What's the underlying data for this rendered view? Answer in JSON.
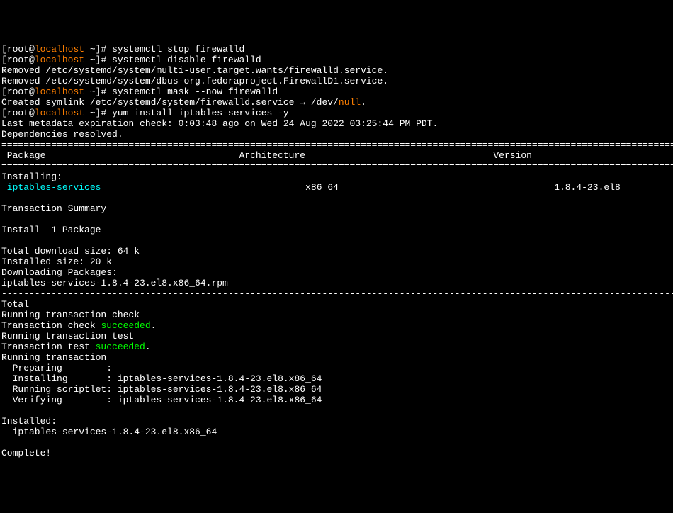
{
  "prompt": {
    "user": "root",
    "at": "@",
    "host": "localhost",
    "tail": " ~]# ",
    "open": "["
  },
  "cmd1": "systemctl stop firewalld",
  "cmd2": "systemctl disable firewalld",
  "removed1": "Removed /etc/systemd/system/multi-user.target.wants/firewalld.service.",
  "removed2": "Removed /etc/systemd/system/dbus-org.fedoraproject.FirewallD1.service.",
  "cmd3": "systemctl mask --now firewalld",
  "symlink1": "Created symlink /etc/systemd/system/firewalld.service → /dev/",
  "nullword": "null",
  "symlink2": ".",
  "cmd4": "yum install iptables-services -y",
  "metadata": "Last metadata expiration check: 0:03:48 ago on Wed 24 Aug 2022 03:25:44 PM PDT.",
  "depres": "Dependencies resolved.",
  "hdr_pkg": " Package",
  "hdr_arch": "Architecture",
  "hdr_ver": "Version",
  "installing": "Installing:",
  "pkg_name": " iptables-services",
  "pkg_arch": "x86_64",
  "pkg_ver": "1.8.4-23.el8",
  "txsummary": "Transaction Summary",
  "install1": "Install  1 Package",
  "dlsize": "Total download size: 64 k",
  "instsize": "Installed size: 20 k",
  "dlpkgs": "Downloading Packages:",
  "rpm": "iptables-services-1.8.4-23.el8.x86_64.rpm",
  "total": "Total",
  "rtcheck": "Running transaction check",
  "tcheck1": "Transaction check ",
  "succeeded": "succeeded",
  "dot": ".",
  "rttest": "Running transaction test",
  "ttest1": "Transaction test ",
  "rtx": "Running transaction",
  "prep": "  Preparing        :",
  "inst": "  Installing       : iptables-services-1.8.4-23.el8.x86_64",
  "script": "  Running scriptlet: iptables-services-1.8.4-23.el8.x86_64",
  "verify": "  Verifying        : iptables-services-1.8.4-23.el8.x86_64",
  "installed": "Installed:",
  "instpkg": "  iptables-services-1.8.4-23.el8.x86_64",
  "complete": "Complete!",
  "eqline": "==============================================================================================================================",
  "dashline": "------------------------------------------------------------------------------------------------------------------------------",
  "sp_arch": "                                   ",
  "sp_ver": "                                  ",
  "sp_arch2": "                                     ",
  "sp_ver2": "                                       "
}
